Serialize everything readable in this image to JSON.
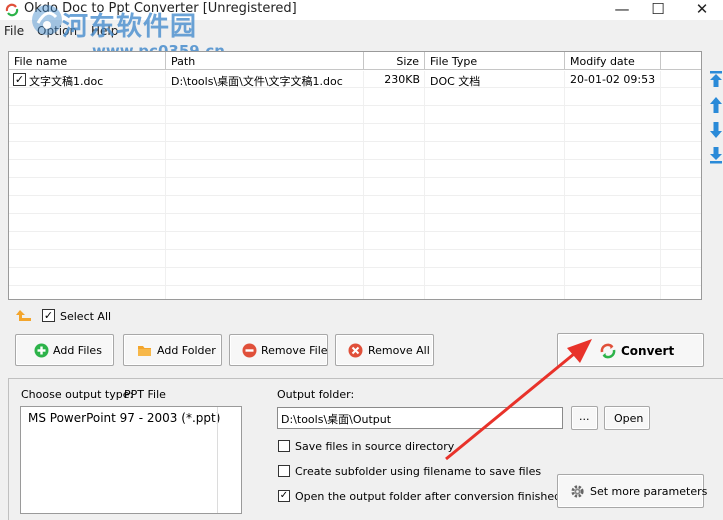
{
  "window": {
    "title": "Okdo Doc to Ppt Converter [Unregistered]",
    "minimize_symbol": "—",
    "maximize_symbol": "☐",
    "close_symbol": "✕"
  },
  "menu": {
    "items": [
      "File",
      "Option",
      "Help"
    ]
  },
  "watermark": {
    "title": "河东软件园",
    "url": "www.pc0359.cn"
  },
  "file_table": {
    "columns": [
      "File name",
      "Path",
      "Size",
      "File Type",
      "Modify date"
    ],
    "rows": [
      {
        "checked": true,
        "name": "文字文稿1.doc",
        "path": "D:\\tools\\桌面\\文件\\文字文稿1.doc",
        "size": "230KB",
        "type": "DOC 文档",
        "date": "20-01-02 09:53"
      }
    ]
  },
  "select_all": {
    "label": "Select All",
    "checked": true
  },
  "buttons": {
    "add_files": "Add Files",
    "add_folder": "Add Folder",
    "remove_file": "Remove File",
    "remove_all": "Remove All",
    "convert": "Convert",
    "open": "Open",
    "browse": "...",
    "set_params": "Set more parameters"
  },
  "output": {
    "type_label": "Choose output type:",
    "type_value": "PPT File",
    "formats": [
      "MS PowerPoint 97 - 2003 (*.ppt)"
    ],
    "folder_label": "Output folder:",
    "folder_value": "D:\\tools\\桌面\\Output",
    "options": [
      {
        "label": "Save files in source directory",
        "checked": false
      },
      {
        "label": "Create subfolder using filename to save files",
        "checked": false
      },
      {
        "label": "Open the output folder after conversion finished",
        "checked": true
      }
    ]
  },
  "colors": {
    "arrow_annotation": "#e8322a",
    "side_arrow_blue": "#2a8ad8",
    "add_icon_green": "#2db34a",
    "remove_icon_red": "#e0503a",
    "folder_icon_orange": "#f3a52c"
  }
}
